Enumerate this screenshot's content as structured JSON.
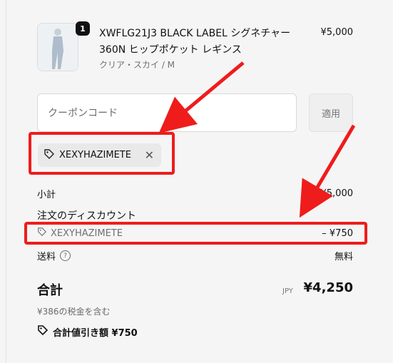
{
  "product": {
    "quantity": "1",
    "title": "XWFLG21J3 BLACK LABEL シグネチャー 360N ヒップポケット レギンス",
    "variant": "クリア・スカイ / M",
    "price": "¥5,000"
  },
  "coupon": {
    "placeholder": "クーポンコード",
    "apply_label": "適用"
  },
  "discount": {
    "code": "XEXYHAZIMETE",
    "remove_glyph": "✕"
  },
  "summary": {
    "subtotal_label": "小計",
    "subtotal_value": "¥5,000",
    "discount_title": "注文のディスカウント",
    "discount_code": "XEXYHAZIMETE",
    "discount_value": "– ¥750",
    "shipping_label": "送料",
    "help_glyph": "?",
    "shipping_value": "無料"
  },
  "total": {
    "label": "合計",
    "currency": "JPY",
    "amount": "¥4,250",
    "tax_note": "¥386の税金を含む",
    "savings": "合計値引き額 ¥750"
  },
  "colors": {
    "highlight": "#ef1c1c",
    "background": "#f5f5f5"
  }
}
